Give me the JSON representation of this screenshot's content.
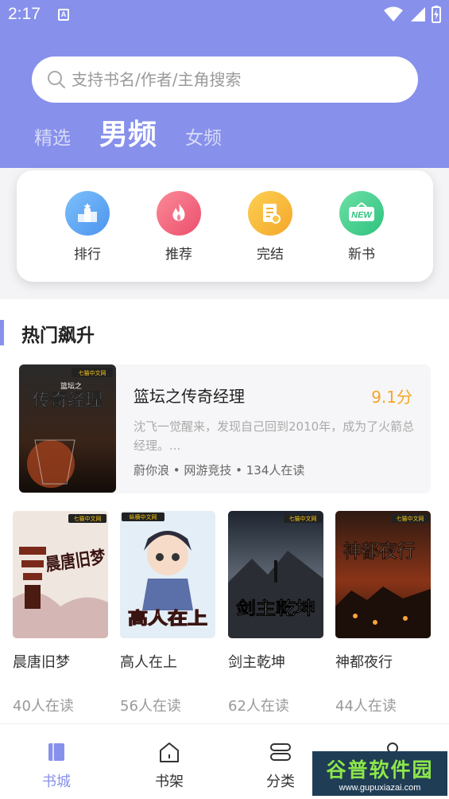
{
  "status": {
    "time": "2:17",
    "sim_label": "A"
  },
  "search": {
    "placeholder": "支持书名/作者/主角搜索"
  },
  "tabs": [
    {
      "label": "精选",
      "active": false
    },
    {
      "label": "男频",
      "active": true
    },
    {
      "label": "女频",
      "active": false
    }
  ],
  "quick_links": [
    {
      "label": "排行",
      "icon": "ranking-icon",
      "color": "#5aa6f2"
    },
    {
      "label": "推荐",
      "icon": "fire-icon",
      "color": "#f0607a"
    },
    {
      "label": "完结",
      "icon": "document-icon",
      "color": "#f7b733"
    },
    {
      "label": "新书",
      "icon": "new-badge-icon",
      "color": "#3ecf8e",
      "badge_text": "NEW"
    }
  ],
  "section": {
    "title": "热门飙升"
  },
  "featured": {
    "title": "篮坛之传奇经理",
    "score": "9.1分",
    "description": "沈飞一觉醒来，发现自己回到2010年，成为了火箭总经理。...",
    "meta": "蔚你浪 • 网游竞技 • 134人在读",
    "cover_text": "传奇经理",
    "cover_small": "篮坛之",
    "publisher": "七猫中文网"
  },
  "books": [
    {
      "title": "晨唐旧梦",
      "readers": "40人在读",
      "cover_text": "晨唐旧梦",
      "publisher": "七猫中文网"
    },
    {
      "title": "高人在上",
      "readers": "56人在读",
      "cover_text": "高人在上",
      "publisher": "纵横中文网"
    },
    {
      "title": "剑主乾坤",
      "readers": "62人在读",
      "cover_text": "剑主乾坤",
      "publisher": "七猫中文网"
    },
    {
      "title": "神都夜行",
      "readers": "44人在读",
      "cover_text": "神都夜行",
      "publisher": "七猫中文网"
    }
  ],
  "bottom_nav": [
    {
      "label": "书城",
      "active": true
    },
    {
      "label": "书架",
      "active": false
    },
    {
      "label": "分类",
      "active": false
    },
    {
      "label": "我的",
      "active": false
    }
  ],
  "watermark": {
    "main": "谷普软件园",
    "sub": "www.gupuxiazai.com"
  }
}
